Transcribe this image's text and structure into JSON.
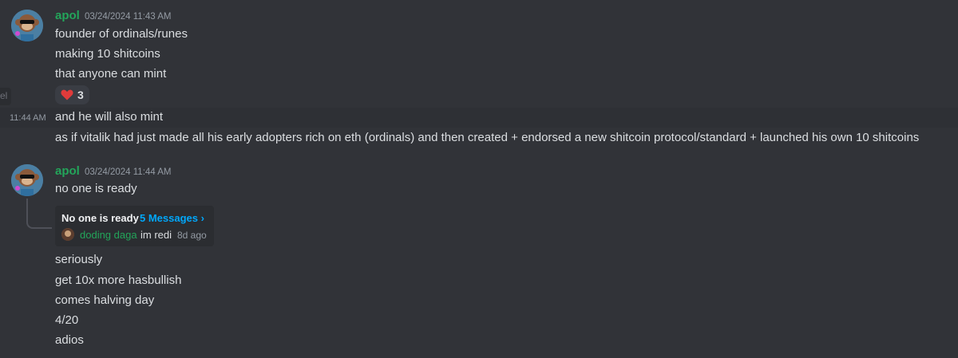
{
  "sidebar_fragment": "el",
  "group1": {
    "username": "apol",
    "timestamp": "03/24/2024 11:43 AM",
    "lines": [
      "founder of ordinals/runes",
      "making 10 shitcoins",
      "that anyone can mint"
    ],
    "reaction": {
      "emoji": "heart-icon",
      "count": "3"
    }
  },
  "group2": {
    "hover_timestamp": "11:44 AM",
    "lines": [
      "and he will also mint",
      "as if vitalik had just made all his early adopters rich on eth (ordinals) and then created + endorsed a new shitcoin protocol/standard + launched his own 10 shitcoins"
    ]
  },
  "group3": {
    "username": "apol",
    "timestamp": "03/24/2024 11:44 AM",
    "line": "no one is ready",
    "thread": {
      "name": "No one is ready",
      "count": "5 Messages ›",
      "last_user": "doding daga",
      "last_preview": "im redi",
      "last_time": "8d ago"
    },
    "after_lines": [
      "seriously",
      "get 10x more hasbullish",
      "comes halving day",
      "4/20",
      "adios"
    ]
  },
  "colors": {
    "background": "#313338",
    "username": "#23a55a",
    "link": "#00a8fc",
    "heart": "#e03b3b"
  }
}
